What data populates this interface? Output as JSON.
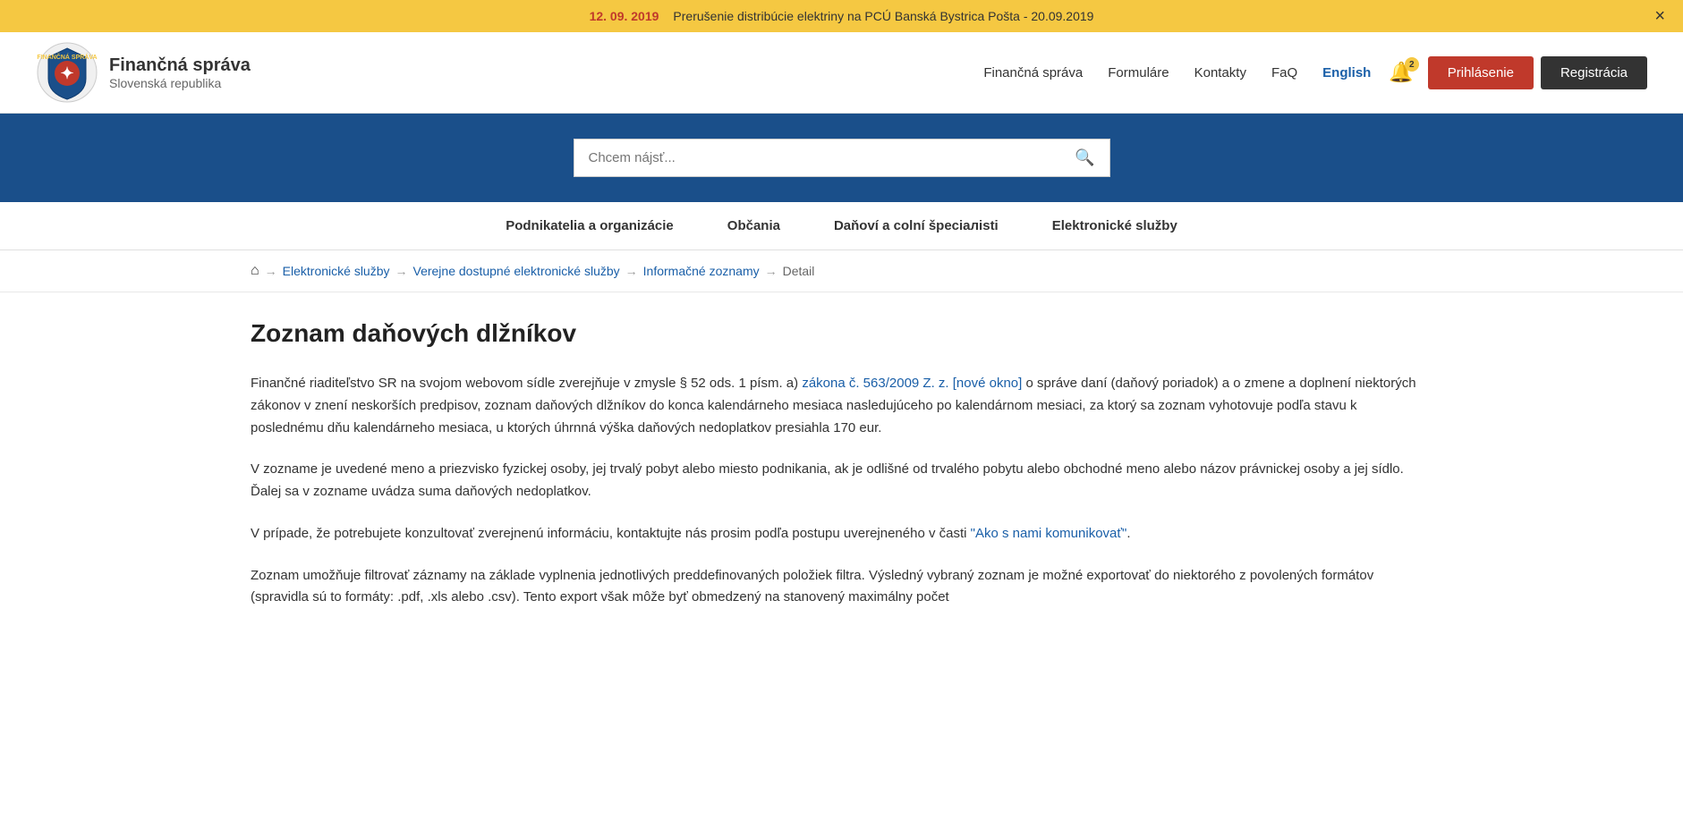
{
  "announcement": {
    "date": "12. 09. 2019",
    "text": "Prerušenie distribúcie elektriny na PCÚ Banská Bystrica Pošta - 20.09.2019",
    "close_icon": "×"
  },
  "header": {
    "logo_title": "Finančná správa",
    "logo_subtitle": "Slovenská republika",
    "nav": {
      "links": [
        {
          "label": "Finančná správa",
          "key": "financna-sprava"
        },
        {
          "label": "Formuláre",
          "key": "formulare"
        },
        {
          "label": "Kontakty",
          "key": "kontakty"
        },
        {
          "label": "FaQ",
          "key": "faq"
        },
        {
          "label": "English",
          "key": "english"
        }
      ]
    },
    "bell_count": "2",
    "btn_login": "Prihlásenie",
    "btn_register": "Registrácia"
  },
  "search": {
    "placeholder": "Chcem nájsť..."
  },
  "main_nav": {
    "items": [
      {
        "label": "Podnikatelia a organizácie"
      },
      {
        "label": "Občania"
      },
      {
        "label": "Daňoví a colní špeciалisti"
      },
      {
        "label": "Elektronické služby"
      }
    ]
  },
  "breadcrumb": {
    "home_icon": "⌂",
    "items": [
      {
        "label": "Elektronické služby",
        "link": true
      },
      {
        "label": "Verejne dostupné elektronické služby",
        "link": true
      },
      {
        "label": "Informačné zoznamy",
        "link": true
      },
      {
        "label": "Detail",
        "link": false
      }
    ]
  },
  "page": {
    "title": "Zoznam daňových dlžníkov",
    "paragraphs": [
      {
        "id": "p1",
        "before_link": "Finančné riaditeľstvo SR na svojom webovom sídle zverejňuje v zmysle § 52 ods. 1 písm. a) ",
        "link_text": "zákona č. 563/2009 Z. z. [nové okno]",
        "after_link": " o správe daní (daňový poriadok) a o zmene a doplnení niektorých zákonov v znení neskorších predpisov, zoznam daňových dlžníkov do konca kalendárneho mesiaca nasledujúceho po kalendárnom mesiaci, za ktorý sa zoznam vyhotovuje podľa stavu k poslednému dňu kalendárneho mesiaca, u ktorých úhrnná výška daňových nedoplatkov presiahla 170 eur."
      },
      {
        "id": "p2",
        "text": "V zozname je uvedené meno a priezvisko fyzickej osoby, jej trvalý pobyt alebo miesto podnikania, ak je odlišné od trvalého pobytu alebo obchodné meno alebo názov právnickej osoby a jej sídlo. Ďalej sa v zozname uvádza suma daňových nedoplatkov."
      },
      {
        "id": "p3",
        "before_link": "V prípade, že potrebujete konzultovať zverejnenú informáciu, kontaktujte nás prosim podľa postupu uverejneného v časti ",
        "link_text": "\"Ako s nami komunikovať\"",
        "after_link": "."
      },
      {
        "id": "p4",
        "text": "Zoznam umožňuje filtrovať záznamy na základe vyplnenia jednotlivých preddefinovaných položiek filtra. Výsledný vybraný zoznam je možné exportovať do niektorého z povolených formátov (spravidla sú to formáty: .pdf, .xls alebo .csv). Tento export však môže byť obmedzený na stanovený maximálny počet"
      }
    ]
  }
}
